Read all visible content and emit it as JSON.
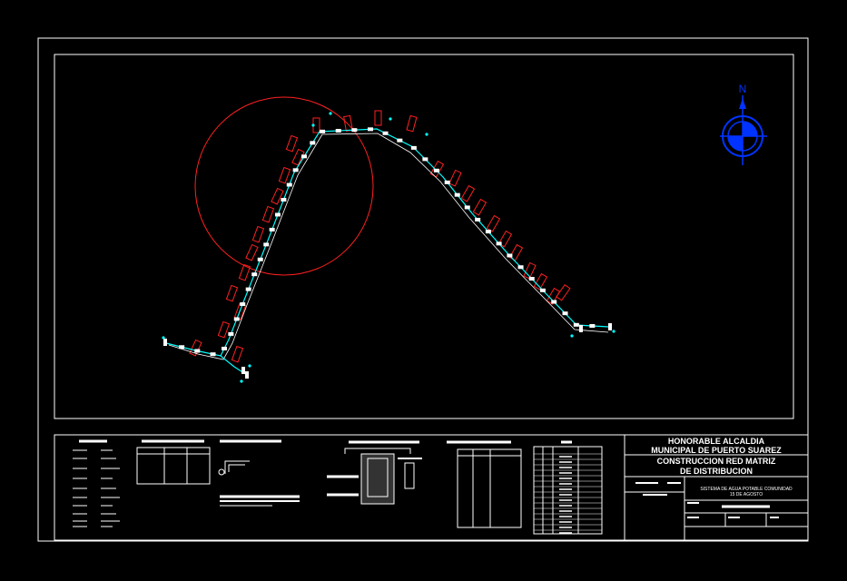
{
  "north_label": "N",
  "title_block": {
    "line1": "HONORABLE ALCALDIA",
    "line2": "MUNICIPAL DE PUERTO SUAREZ",
    "line3": "CONSTRUCCION  RED MATRIZ",
    "line4": "DE DISTRIBUCION",
    "project_line1": "SISTEMA DE AGUA POTABLE COMUNIDAD",
    "project_line2": "15 DE AGOSTO"
  },
  "colors": {
    "background": "#000000",
    "frame": "#ffffff",
    "pipe": "#00ffff",
    "lots": "#ff2020",
    "circle": "#ff2020",
    "compass": "#0033ff",
    "nodes": "#ffffff"
  }
}
